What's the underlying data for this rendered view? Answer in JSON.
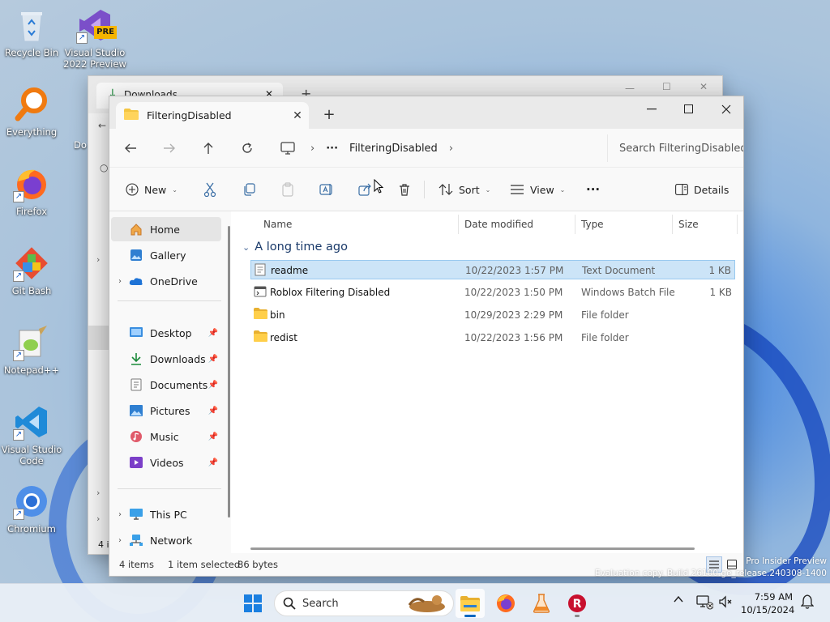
{
  "desktop": {
    "icons": [
      {
        "label_1": "Recycle Bin",
        "label_2": ""
      },
      {
        "label_1": "Visual Studio",
        "label_2": "2022 Preview",
        "badge": "PRE"
      },
      {
        "label_1": "Everything",
        "label_2": ""
      },
      {
        "label_1": "Firefox",
        "label_2": ""
      },
      {
        "label_1": "Git Bash",
        "label_2": ""
      },
      {
        "label_1": "Notepad++",
        "label_2": ""
      },
      {
        "label_1": "Visual Studio",
        "label_2": "Code"
      },
      {
        "label_1": "Chromium",
        "label_2": ""
      }
    ],
    "watermark_line1": "Pro Insider Preview",
    "watermark_line2": "Evaluation copy. Build 26100.ge_release.240308-1400"
  },
  "back_window": {
    "tab_label": "Downloads",
    "partial_label": "Do",
    "status_partial": "4 i"
  },
  "window": {
    "tab_label": "FilteringDisabled",
    "address": {
      "crumb_more": "···",
      "crumb_current": "FilteringDisabled",
      "search_placeholder": "Search FilteringDisabled"
    },
    "toolbar": {
      "new_label": "New",
      "sort_label": "Sort",
      "view_label": "View",
      "more_label": "···",
      "details_label": "Details"
    },
    "nav": {
      "home": "Home",
      "gallery": "Gallery",
      "onedrive": "OneDrive",
      "desktop": "Desktop",
      "downloads": "Downloads",
      "documents": "Documents",
      "pictures": "Pictures",
      "music": "Music",
      "videos": "Videos",
      "thispc": "This PC",
      "network": "Network"
    },
    "columns": {
      "name": "Name",
      "date": "Date modified",
      "type": "Type",
      "size": "Size"
    },
    "group_label": "A long time ago",
    "files": [
      {
        "name": "readme",
        "date": "10/22/2023 1:57 PM",
        "type": "Text Document",
        "size": "1 KB",
        "icon": "text-file-icon"
      },
      {
        "name": "Roblox Filtering Disabled",
        "date": "10/22/2023 1:50 PM",
        "type": "Windows Batch File",
        "size": "1 KB",
        "icon": "batch-file-icon"
      },
      {
        "name": "bin",
        "date": "10/29/2023 2:29 PM",
        "type": "File folder",
        "size": "",
        "icon": "folder-icon"
      },
      {
        "name": "redist",
        "date": "10/22/2023 1:56 PM",
        "type": "File folder",
        "size": "",
        "icon": "folder-icon"
      }
    ],
    "status": {
      "items": "4 items",
      "selected": "1 item selected",
      "bytes": "86 bytes"
    }
  },
  "taskbar": {
    "search_label": "Search",
    "time": "7:59 AM",
    "date": "10/15/2024"
  },
  "colors": {
    "accent": "#0067c0",
    "selection": "#cce4f7",
    "folder": "#f4c542"
  }
}
